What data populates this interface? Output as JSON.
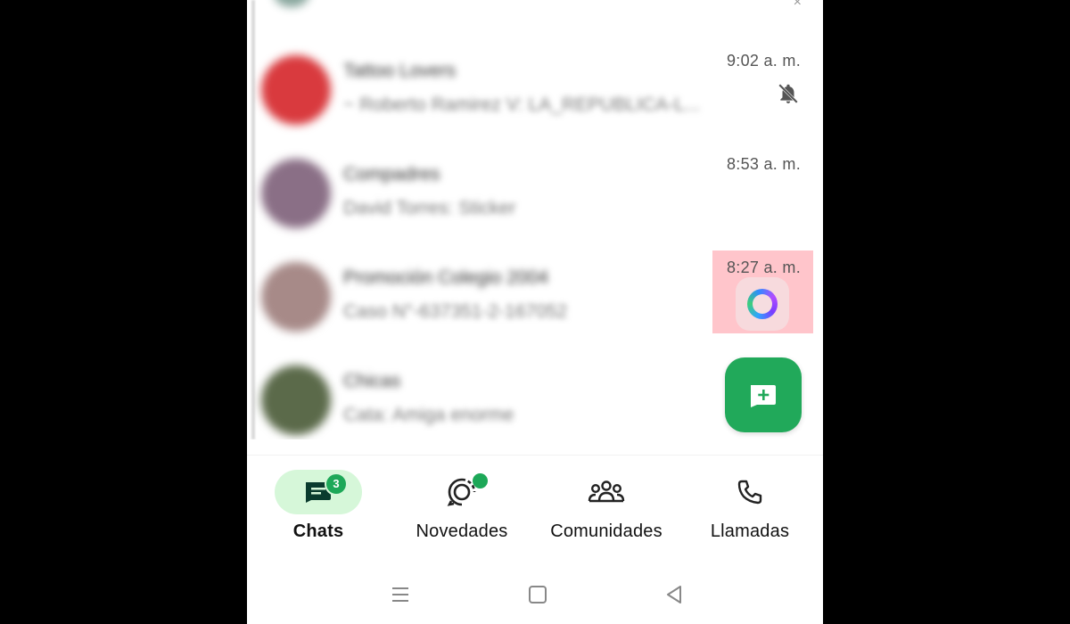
{
  "chats": [
    {
      "name": "Tattoo Lovers",
      "preview": "~ Roberto Ramirez V: LA_REPUBLICA-L...",
      "time": "9:02 a. m.",
      "muted": true,
      "avatar_color": "#d93a3e"
    },
    {
      "name": "Compadres",
      "preview": "David Torres: Sticker",
      "time": "8:53 a. m.",
      "muted": false,
      "avatar_color": "#8a6f86"
    },
    {
      "name": "Promoción Colegio 2004",
      "preview": "Caso N°-637351-2-167052",
      "time": "8:27 a. m.",
      "muted": false,
      "avatar_color": "#a78a88"
    },
    {
      "name": "Chicas",
      "preview": "Cata: Amiga enorme",
      "time": "",
      "muted": false,
      "avatar_color": "#5b6a4a"
    }
  ],
  "nav": {
    "chats": {
      "label": "Chats",
      "badge": "3",
      "icon": "chats-icon"
    },
    "updates": {
      "label": "Novedades",
      "icon": "status-icon"
    },
    "communities": {
      "label": "Comunidades",
      "icon": "communities-icon"
    },
    "calls": {
      "label": "Llamadas",
      "icon": "phone-icon"
    }
  },
  "colors": {
    "accent": "#21a95a",
    "active_pill": "#d6f7d9",
    "highlight": "#ff96a0"
  }
}
